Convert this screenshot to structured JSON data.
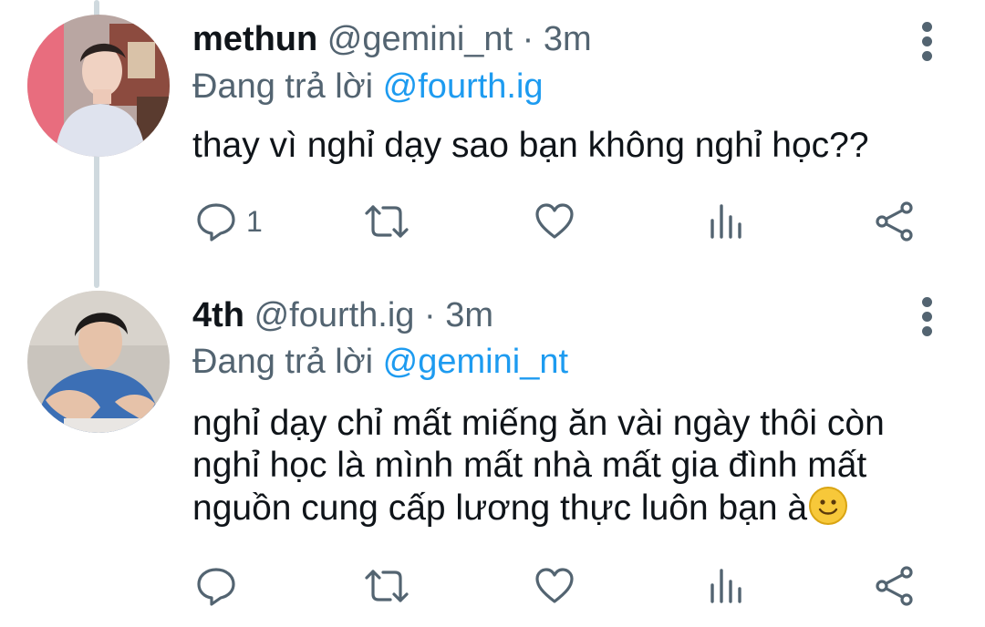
{
  "tweets": [
    {
      "author_name": "methun",
      "handle_time": "@gemini_nt · 3m",
      "reply_prefix": "Đang trả lời ",
      "reply_to": "@fourth.ig",
      "text": "thay vì nghỉ dạy sao bạn không nghỉ học??",
      "reply_count": "1",
      "icons": [
        "reply-icon",
        "retweet-icon",
        "like-icon",
        "analytics-icon",
        "share-icon",
        "more-icon"
      ]
    },
    {
      "author_name": "4th",
      "handle_time": "@fourth.ig · 3m",
      "reply_prefix": "Đang trả lời ",
      "reply_to": "@gemini_nt",
      "text_lines": [
        "nghỉ dạy chỉ mất miếng ăn vài ngày thôi còn",
        "nghỉ học là mình mất nhà mất gia đình mất",
        "nguồn cung cấp lương thực luôn bạn à"
      ],
      "emoji": "slightly-smiling-face",
      "reply_count": "",
      "icons": [
        "reply-icon",
        "retweet-icon",
        "like-icon",
        "analytics-icon",
        "share-icon",
        "more-icon"
      ]
    }
  ],
  "colors": {
    "text": "#0f1419",
    "secondary": "#536471",
    "link": "#1d9bf0",
    "thread_line": "#cfd9de"
  }
}
